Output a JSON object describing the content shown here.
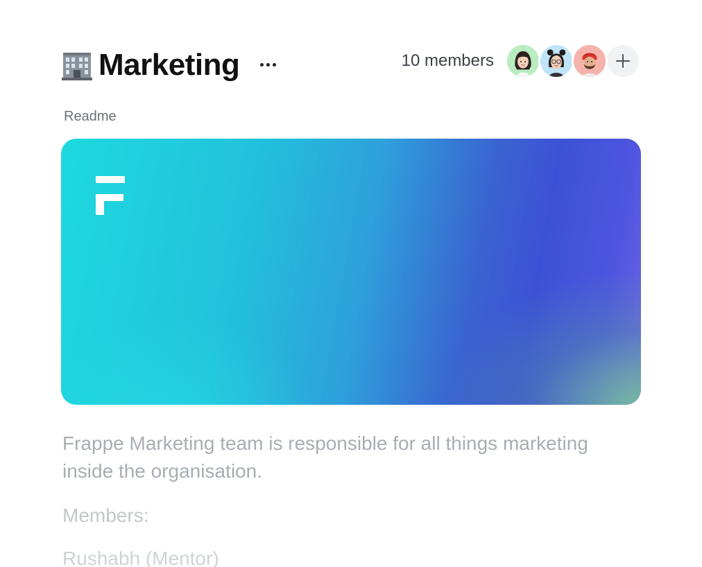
{
  "team": {
    "emoji_icon": "office-building-icon",
    "name": "Marketing",
    "more_icon": "more-horizontal-icon"
  },
  "members": {
    "count_label": "10 members",
    "avatars": [
      {
        "name": "avatar-woman-dark-hair",
        "bg": "#b9ecc0"
      },
      {
        "name": "avatar-woman-glasses-buns",
        "bg": "#bfe3f7"
      },
      {
        "name": "avatar-man-red-turban",
        "bg": "#f6b3ac"
      }
    ],
    "add_icon": "plus-icon"
  },
  "readme": {
    "label": "Readme",
    "banner_logo_icon": "frappe-logo-icon",
    "description": "Frappe Marketing team is responsible for all things marketing inside the organisation.",
    "members_heading": "Members:",
    "member_line": "Rushabh (Mentor)"
  }
}
